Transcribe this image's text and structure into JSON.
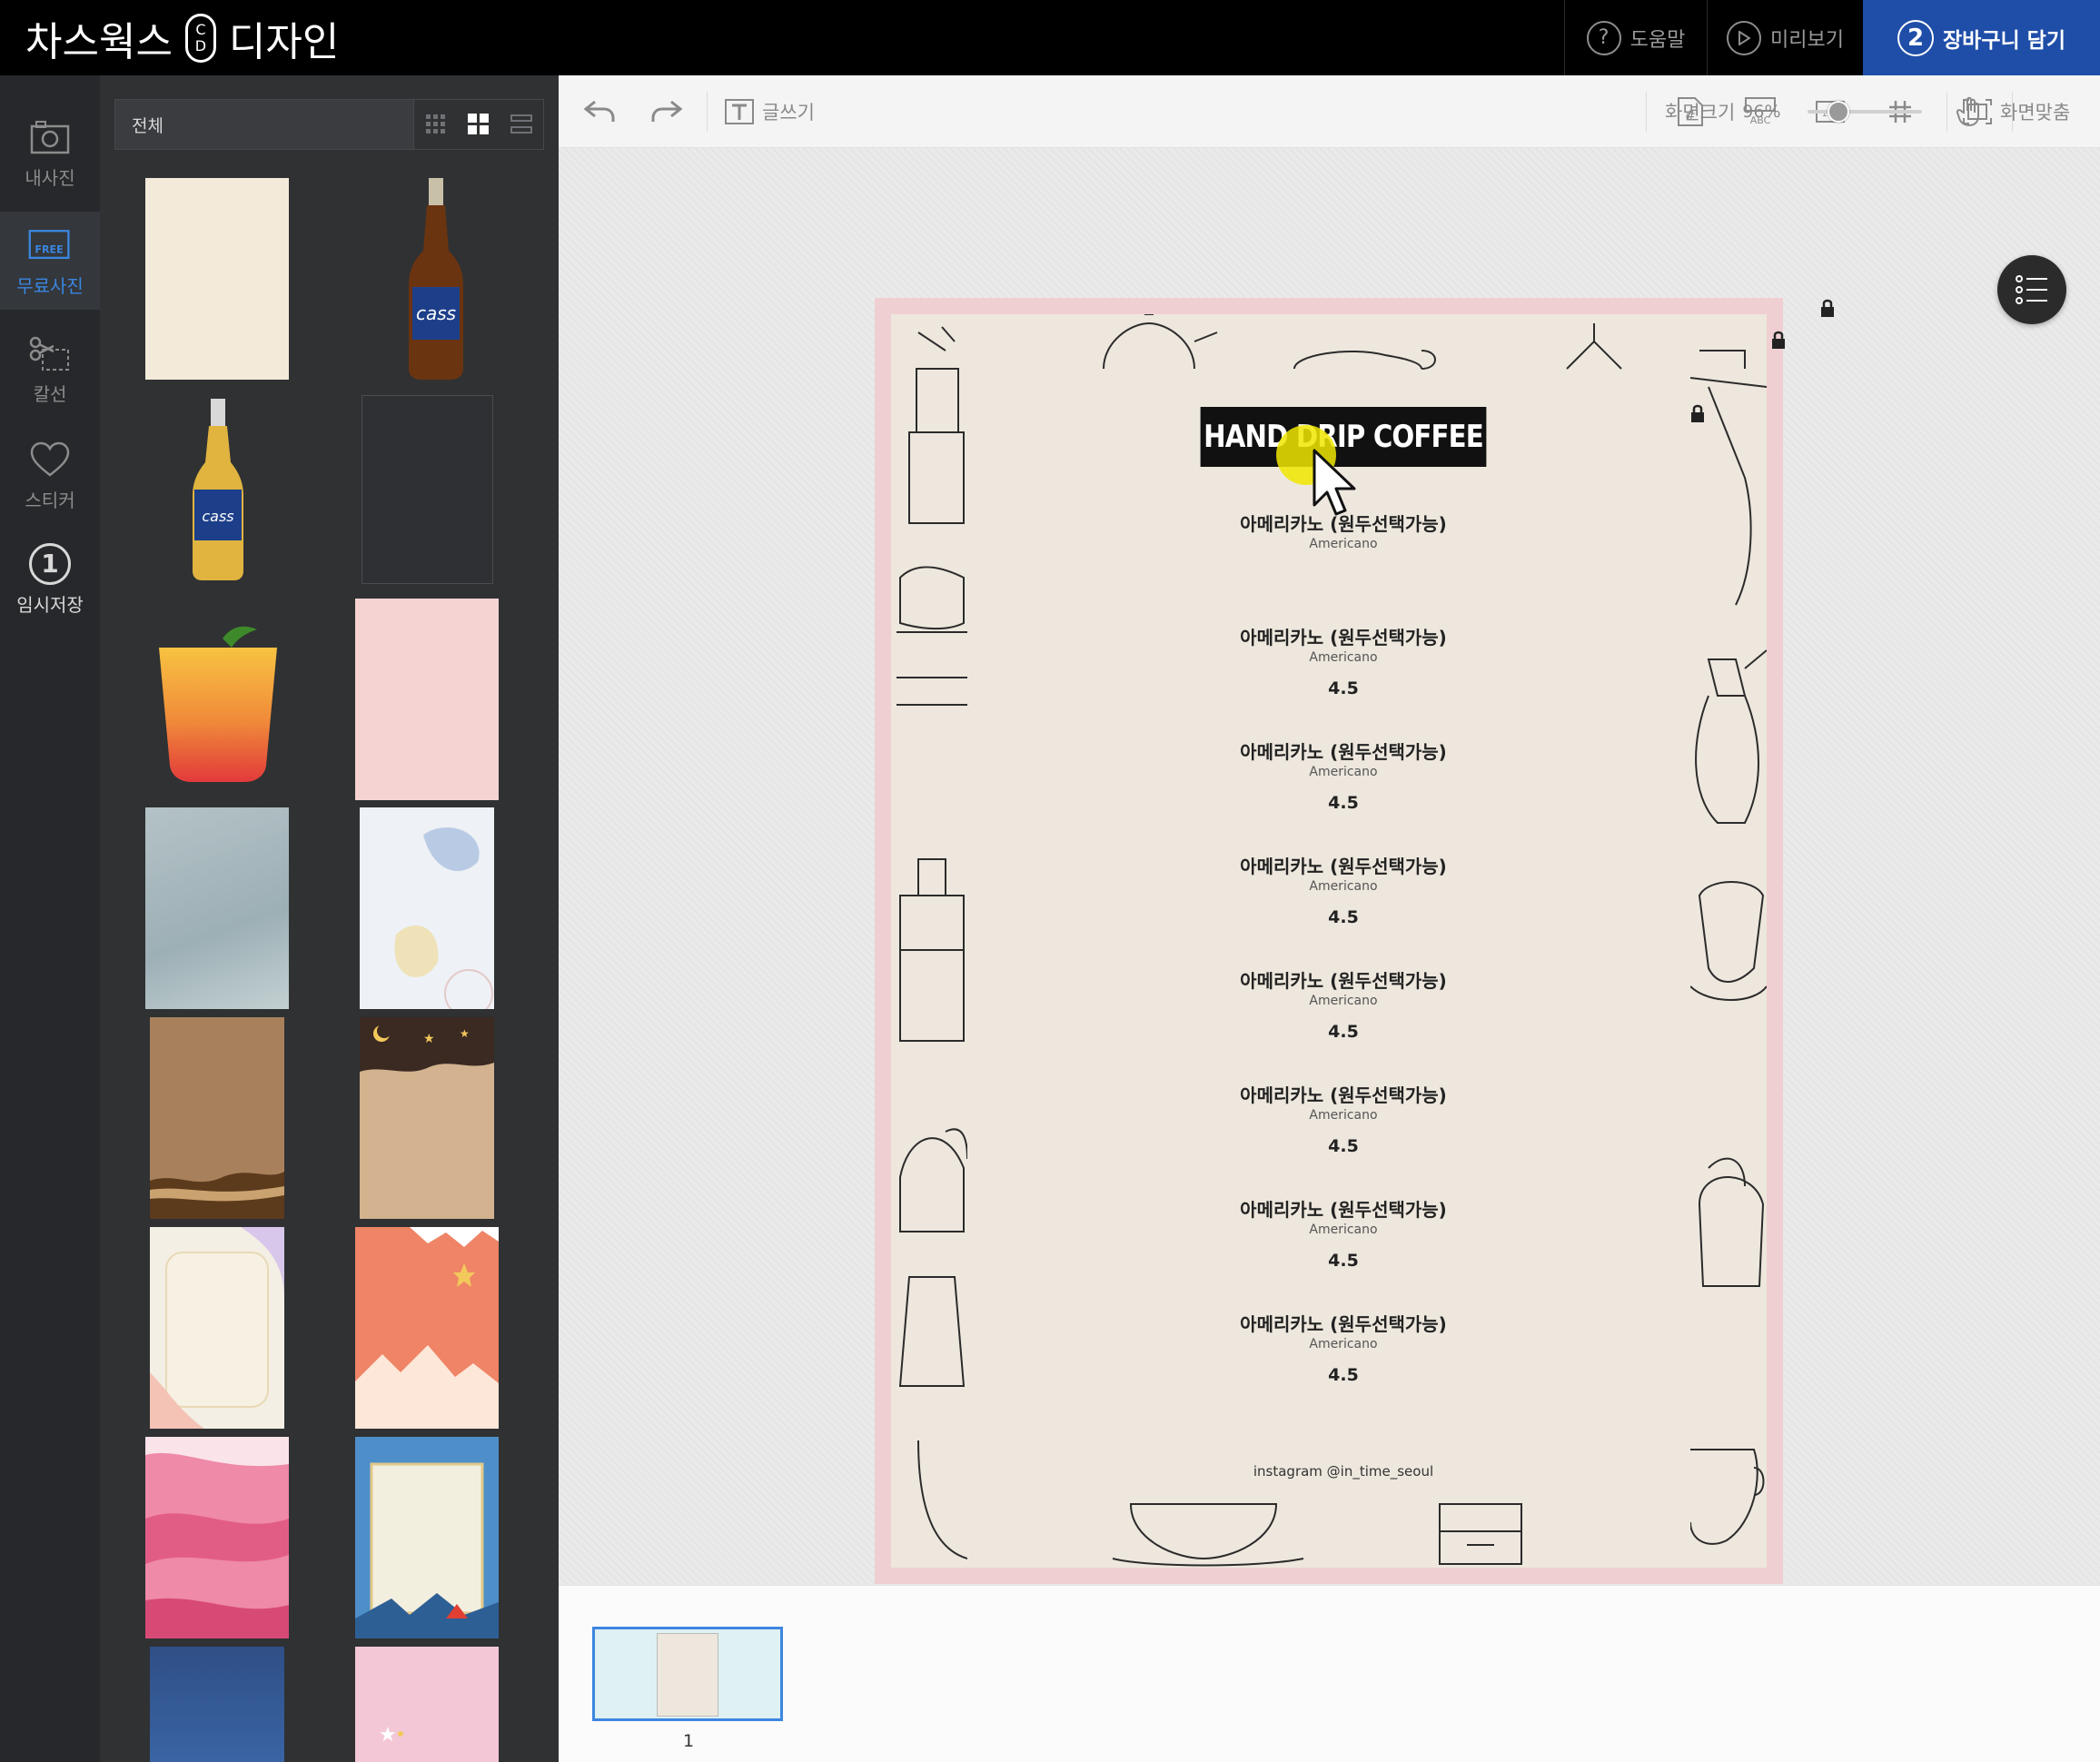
{
  "app": {
    "brand_left": "차스웍스",
    "brand_logo_top": "C",
    "brand_logo_bottom": "D",
    "brand_right": "디자인"
  },
  "header": {
    "help_label": "도움말",
    "preview_label": "미리보기",
    "cart_step": "2",
    "cart_label": "장바구니 담기"
  },
  "nav": {
    "items": [
      {
        "label": "내사진",
        "icon": "camera-icon"
      },
      {
        "label": "무료사진",
        "icon": "free-photo-icon",
        "badge": "FREE",
        "active": true
      },
      {
        "label": "칼선",
        "icon": "scissors-icon"
      },
      {
        "label": "스티커",
        "icon": "heart-icon"
      },
      {
        "label": "임시저장",
        "icon": "save-count-icon",
        "count": "1"
      }
    ]
  },
  "panel": {
    "filter_value": "전체",
    "thumbs": [
      {
        "name": "beige-paper",
        "color": "#f4ead9"
      },
      {
        "name": "beer-bottle-brown",
        "color": "#7a3d12"
      },
      {
        "name": "beer-bottle-clear",
        "color": "#d9b24a"
      },
      {
        "name": "dark-blank",
        "color": "#2e3033"
      },
      {
        "name": "mango-drink",
        "color": "#f1a339"
      },
      {
        "name": "pink-paper",
        "color": "#f5d3d2"
      },
      {
        "name": "grey-blue-watercolor",
        "color": "#a8b8bd"
      },
      {
        "name": "pastel-shapes",
        "color": "#e9edf2"
      },
      {
        "name": "brown-paper",
        "color": "#a8815c"
      },
      {
        "name": "night-sky-paper",
        "color": "#d2b28f"
      },
      {
        "name": "pastel-frame",
        "color": "#f4efe4"
      },
      {
        "name": "coral-winter",
        "color": "#ef8466"
      },
      {
        "name": "pink-waves",
        "color": "#ef8aa8"
      },
      {
        "name": "blue-camp-frame",
        "color": "#4f8fc9"
      },
      {
        "name": "navy-texture",
        "color": "#3a5f9c"
      },
      {
        "name": "pink-sparkle",
        "color": "#f3c7d6"
      }
    ]
  },
  "toolbar": {
    "write_label": "글쓰기",
    "zoom_label": "화면크기",
    "zoom_value": "96%",
    "zoom_level": 0.22,
    "fit_label": "화면맞춤"
  },
  "design": {
    "title": "HAND DRIP COFFEE",
    "items": [
      {
        "ko": "아메리카노 (원두선택가능)",
        "en": "Americano",
        "price": ""
      },
      {
        "ko": "아메리카노 (원두선택가능)",
        "en": "Americano",
        "price": "4.5"
      },
      {
        "ko": "아메리카노 (원두선택가능)",
        "en": "Americano",
        "price": "4.5"
      },
      {
        "ko": "아메리카노 (원두선택가능)",
        "en": "Americano",
        "price": "4.5"
      },
      {
        "ko": "아메리카노 (원두선택가능)",
        "en": "Americano",
        "price": "4.5"
      },
      {
        "ko": "아메리카노 (원두선택가능)",
        "en": "Americano",
        "price": "4.5"
      },
      {
        "ko": "아메리카노 (원두선택가능)",
        "en": "Americano",
        "price": "4.5"
      },
      {
        "ko": "아메리카노 (원두선택가능)",
        "en": "Americano",
        "price": "4.5"
      }
    ],
    "footer": "instagram @in_time_seoul"
  },
  "pages": {
    "current": "1"
  },
  "colors": {
    "accent": "#1f4ea8",
    "active_nav": "#3a86e0",
    "page_border": "#f0cfd2",
    "paper": "#ede7dd"
  }
}
